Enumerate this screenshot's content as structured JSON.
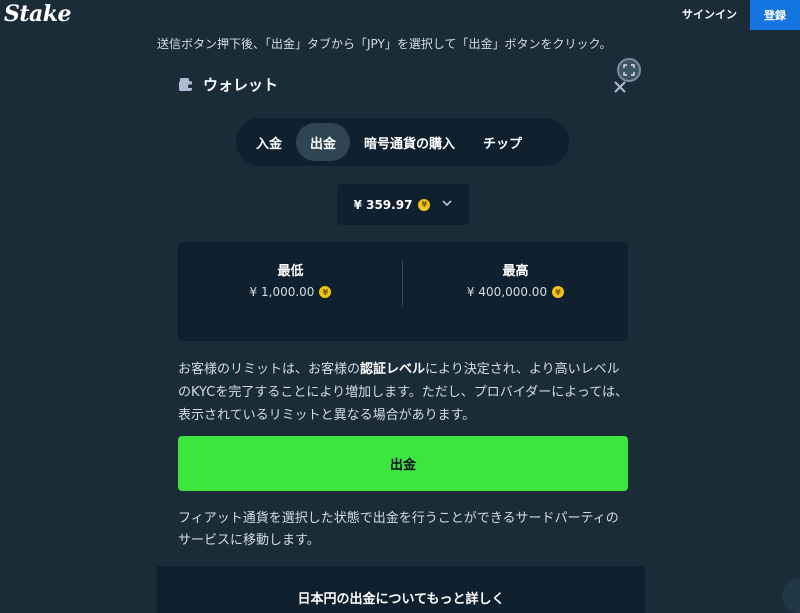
{
  "header": {
    "logo": "Stake",
    "signin_label": "サインイン",
    "register_label": "登録"
  },
  "instruction": "送信ボタン押下後、「出金」タブから「JPY」を選択して「出金」ボタンをクリック。",
  "modal": {
    "title": "ウォレット",
    "tabs": [
      {
        "label": "入金",
        "active": false
      },
      {
        "label": "出金",
        "active": true
      },
      {
        "label": "暗号通貨の購入",
        "active": false
      },
      {
        "label": "チップ",
        "active": false
      }
    ],
    "balance": {
      "value": "¥ 359.97",
      "coin_symbol": "¥"
    },
    "limits": {
      "min_label": "最低",
      "min_value": "¥ 1,000.00",
      "max_label": "最高",
      "max_value": "¥ 400,000.00"
    },
    "description_pre": "お客様のリミットは、お客様の",
    "description_link": "認証レベル",
    "description_post": "により決定され、より高いレベルのKYCを完了することにより増加します。ただし、プロバイダーによっては、表示されているリミットと異なる場合があります。",
    "withdraw_label": "出金",
    "note": "フィアット通貨を選択した状態で出金を行うことができるサードパーティのサービスに移動します。",
    "more_info": "日本円の出金についてもっと詳しく"
  },
  "colors": {
    "background": "#1a2c38",
    "panel": "#0f212e",
    "accent_green": "#3ee540",
    "brand_blue": "#1475e1",
    "coin": "#f0c419"
  }
}
